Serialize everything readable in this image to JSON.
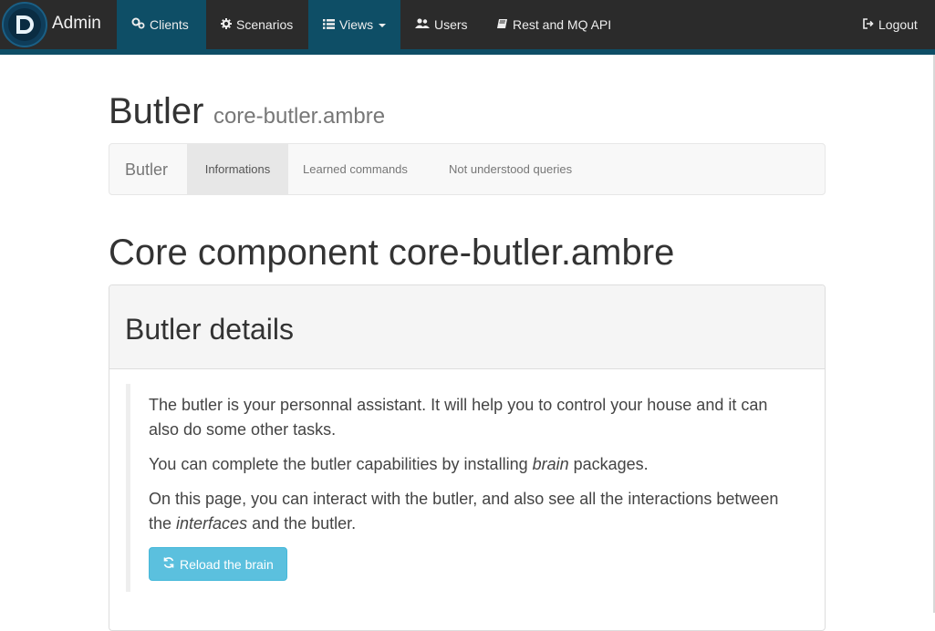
{
  "navbar": {
    "brand": "Admin",
    "items": [
      {
        "label": "Clients",
        "icon": "users-cog-icon",
        "active": true
      },
      {
        "label": "Scenarios",
        "icon": "gear-icon",
        "active": false
      },
      {
        "label": "Views",
        "icon": "list-icon",
        "active": true
      },
      {
        "label": "Users",
        "icon": "users-icon",
        "active": false
      },
      {
        "label": "Rest and MQ API",
        "icon": "book-icon",
        "active": false
      }
    ],
    "logout": "Logout"
  },
  "header": {
    "title": "Butler",
    "subtitle": "core-butler.ambre"
  },
  "subnav": {
    "brand": "Butler",
    "tabs": [
      {
        "label": "Informations",
        "active": true
      },
      {
        "label": "Learned commands",
        "active": false
      },
      {
        "label": "Not understood queries",
        "active": false
      }
    ]
  },
  "section": {
    "title": "Core component core-butler.ambre"
  },
  "panel": {
    "title": "Butler details",
    "para1": "The butler is your personnal assistant. It will help you to control your house and it can also do some other tasks.",
    "para2_before": "You can complete the butler capabilities by installing ",
    "para2_em": "brain",
    "para2_after": " packages.",
    "para3_before": "On this page, you can interact with the butler, and also see all the interactions between the ",
    "para3_em": "interfaces",
    "para3_after": " and the butler.",
    "reload_button": "Reload the brain"
  },
  "colors": {
    "navbar_bg": "#2b2b2b",
    "navbar_accent": "#0e4e66",
    "button_info": "#5bc0de"
  }
}
